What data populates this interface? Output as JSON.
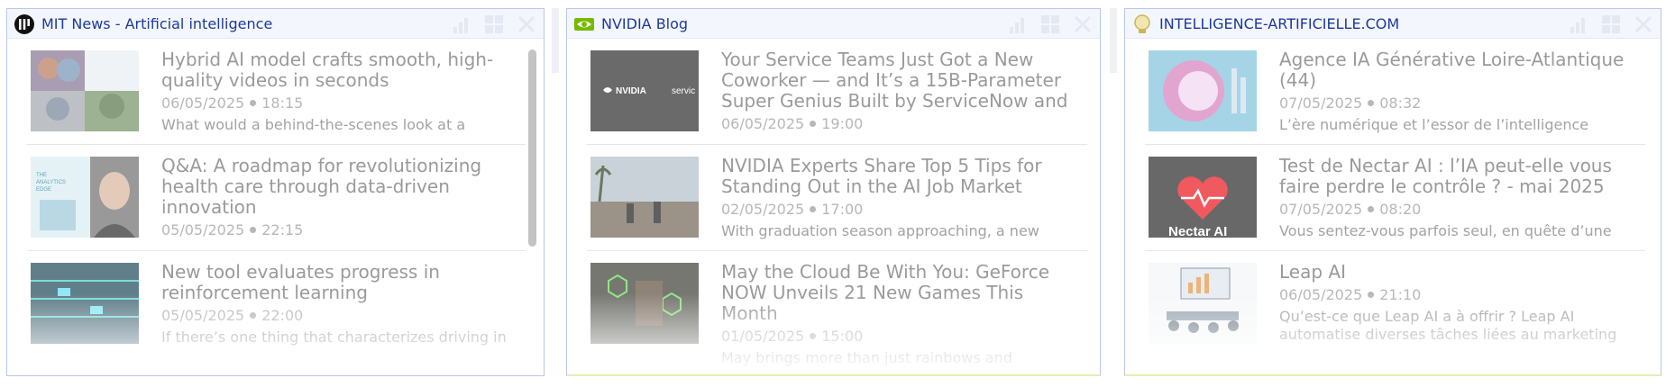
{
  "widgets": [
    {
      "title": "MIT News - Artificial intelligence",
      "icon": "mit-logo-icon",
      "items": [
        {
          "title": "Hybrid AI model crafts smooth, high-quality videos in seconds",
          "date": "06/05/2025",
          "time": "18:15",
          "desc": "What would a behind-the-scenes look at a"
        },
        {
          "title": "Q&A: A roadmap for revolutionizing health care through data-driven innovation",
          "date": "05/05/2025",
          "time": "22:15",
          "desc": ""
        },
        {
          "title": "New tool evaluates progress in reinforcement learning",
          "date": "05/05/2025",
          "time": "22:00",
          "desc": "If there’s one thing that characterizes driving in"
        }
      ],
      "thumb_text": {
        "analytics_cover": "THE ANALYTICS EDGE IN HEALTHCARE"
      }
    },
    {
      "title": "NVIDIA Blog",
      "icon": "nvidia-eye-icon",
      "items": [
        {
          "title": "Your Service Teams Just Got a New Coworker — and It’s a 15B-Parameter Super Genius Built by ServiceNow and",
          "date": "06/05/2025",
          "time": "19:00",
          "desc": ""
        },
        {
          "title": "NVIDIA Experts Share Top 5 Tips for Standing Out in the AI Job Market",
          "date": "02/05/2025",
          "time": "17:00",
          "desc": "With graduation season approaching, a new"
        },
        {
          "title": "May the Cloud Be With You: GeForce NOW Unveils 21 New Games This Month",
          "date": "01/05/2025",
          "time": "15:00",
          "desc": "May brings more than just rainbows and"
        }
      ],
      "thumb_text": {
        "nvidia": "NVIDIA",
        "servicenow": "servic"
      }
    },
    {
      "title": "INTELLIGENCE-ARTIFICIELLE.COM",
      "icon": "brain-bulb-icon",
      "items": [
        {
          "title": "Agence IA Générative Loire-Atlantique (44)",
          "date": "07/05/2025",
          "time": "08:32",
          "desc": "L’ère numérique et l’essor de l’intelligence"
        },
        {
          "title": "Test de Nectar AI : l’IA peut-elle vous faire perdre le contrôle ? - mai 2025",
          "date": "07/05/2025",
          "time": "08:20",
          "desc": "Vous sentez-vous parfois seul, en quête d’une"
        },
        {
          "title": "Leap AI",
          "date": "06/05/2025",
          "time": "21:10",
          "desc": "Qu’est-ce que Leap AI a à offrir ? Leap AI automatise diverses tâches liées au marketing"
        }
      ],
      "thumb_text": {
        "nectar": "Nectar AI"
      }
    }
  ],
  "colors": {
    "title_blue": "#1d3a99",
    "border": "#b9c6ee",
    "nectar_heart": "#f0595d"
  }
}
